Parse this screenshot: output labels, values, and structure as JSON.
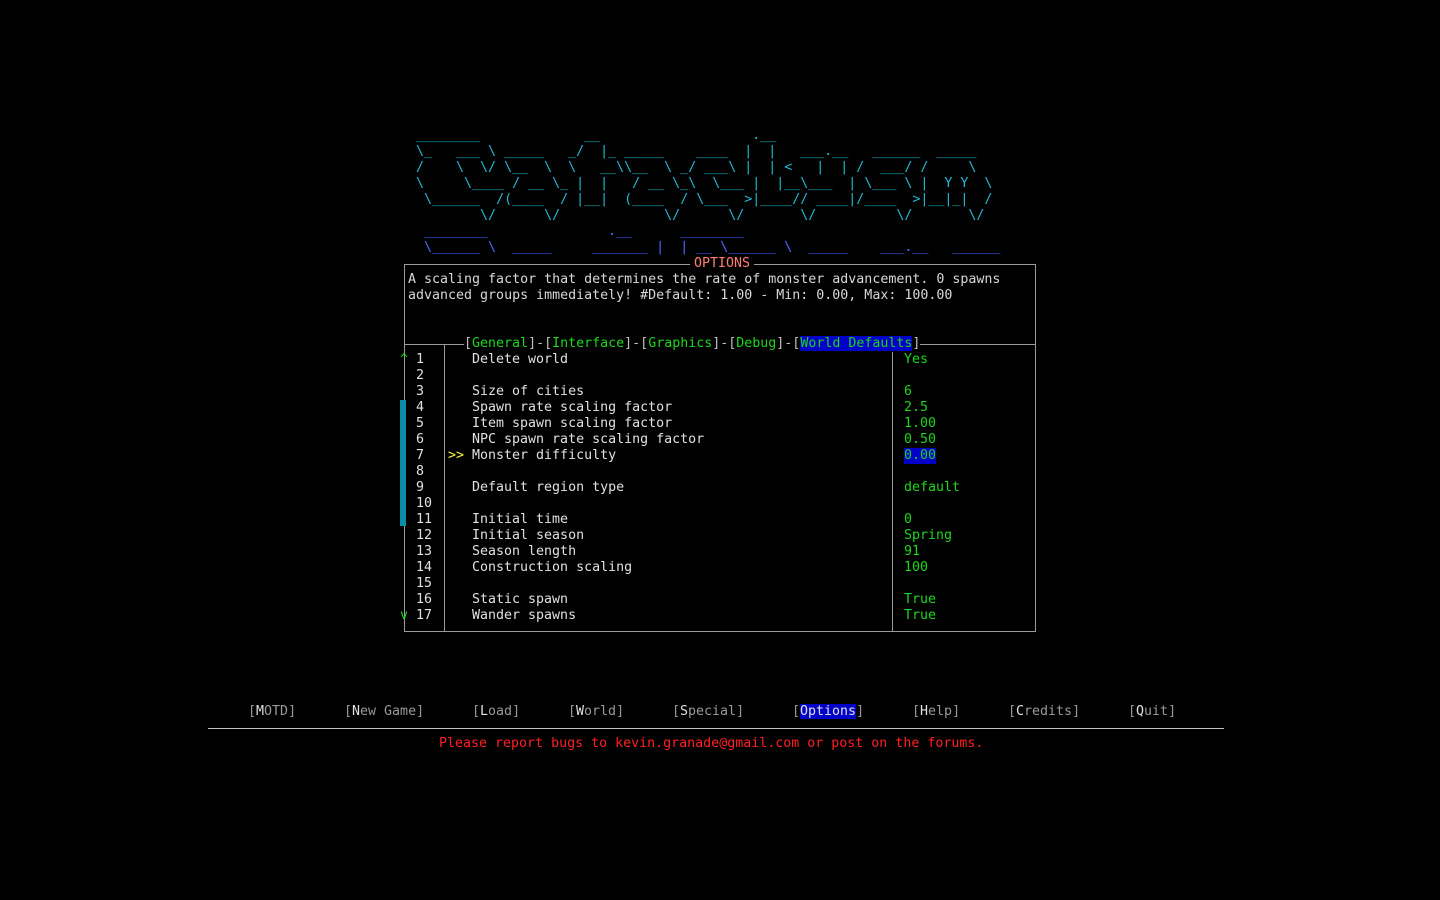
{
  "logo": {
    "cataclysm_lines": [
      "  ________             __                   .__",
      "  \\_   ___ \\ _____   _/  |_ _____    ____  |  |   ___.__   ______  _____",
      "  /    \\  \\/ \\__  \\  \\   __\\\\__  \\ _/ ___\\ |  | <   |  | /  ___/ /     \\",
      "  \\     \\____ / __ \\_ |  |   / __ \\_\\  \\___ |  |__\\___  | \\___ \\ |  Y Y  \\",
      "   \\______  /(____  / |__|  (____  / \\___  >|____// ____|/____  >|__|_|  /",
      "          \\/      \\/             \\/      \\/       \\/          \\/       \\/"
    ],
    "dda_lines": [
      "   ________               .__      ________",
      "   \\______ \\  _____     _______ |  | __ \\______ \\  _____    ___.__   ______"
    ]
  },
  "window": {
    "title": "OPTIONS",
    "description_line1": "A scaling factor that determines the rate of monster advancement. 0 spawns",
    "description_line2": "advanced groups immediately! #Default: 1.00 - Min: 0.00, Max: 100.00"
  },
  "tabs": [
    "General",
    "Interface",
    "Graphics",
    "Debug",
    "World Defaults"
  ],
  "active_tab": "World Defaults",
  "scroll": {
    "up": "^",
    "down": "v"
  },
  "selector": ">>",
  "options": [
    {
      "num": "1",
      "name": "Delete world",
      "value": "Yes"
    },
    {
      "num": "2",
      "name": "",
      "value": ""
    },
    {
      "num": "3",
      "name": "Size of cities",
      "value": "6"
    },
    {
      "num": "4",
      "name": "Spawn rate scaling factor",
      "value": "2.5"
    },
    {
      "num": "5",
      "name": "Item spawn scaling factor",
      "value": "1.00"
    },
    {
      "num": "6",
      "name": "NPC spawn rate scaling factor",
      "value": "0.50"
    },
    {
      "num": "7",
      "name": "Monster difficulty",
      "value": "0.00"
    },
    {
      "num": "8",
      "name": "",
      "value": ""
    },
    {
      "num": "9",
      "name": "Default region type",
      "value": "default"
    },
    {
      "num": "10",
      "name": "",
      "value": ""
    },
    {
      "num": "11",
      "name": "Initial time",
      "value": "0"
    },
    {
      "num": "12",
      "name": "Initial season",
      "value": "Spring"
    },
    {
      "num": "13",
      "name": "Season length",
      "value": "91"
    },
    {
      "num": "14",
      "name": "Construction scaling",
      "value": "100"
    },
    {
      "num": "15",
      "name": "",
      "value": ""
    },
    {
      "num": "16",
      "name": "Static spawn",
      "value": "True"
    },
    {
      "num": "17",
      "name": "Wander spawns",
      "value": "True"
    }
  ],
  "selected_row": 7,
  "main_menu": [
    {
      "hotkey": "M",
      "rest": "OTD"
    },
    {
      "hotkey": "N",
      "rest": "ew Game"
    },
    {
      "hotkey": "L",
      "rest": "oad"
    },
    {
      "hotkey": "W",
      "rest": "orld"
    },
    {
      "hotkey": "S",
      "rest": "pecial"
    },
    {
      "hotkey": "O",
      "rest": "ptions"
    },
    {
      "hotkey": "H",
      "rest": "elp"
    },
    {
      "hotkey": "C",
      "rest": "redits"
    },
    {
      "hotkey": "Q",
      "rest": "uit"
    }
  ],
  "active_menu": "Options",
  "footer": "Please report bugs to kevin.granade@gmail.com or post on the forums.",
  "colors": {
    "logo": "#22bcd6",
    "logo_secondary": "#4a6cff",
    "value": "#1cd81c",
    "highlight": "#0000c8",
    "footer": "#ff2020",
    "title": "#ff8070",
    "selector": "#ffff40"
  }
}
